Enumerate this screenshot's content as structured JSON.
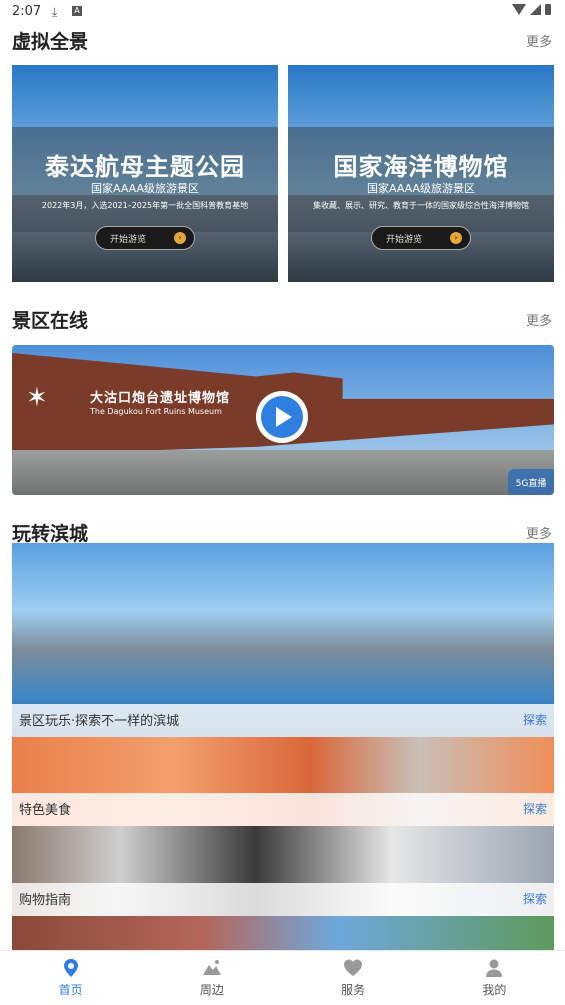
{
  "status": {
    "time": "2:07"
  },
  "virtual_panorama": {
    "title": "虚拟全景",
    "more": "更多",
    "cards": [
      {
        "title": "泰达航母主题公园",
        "grade": "国家AAAA级旅游景区",
        "desc": "2022年3月，入选2021–2025年第一批全国科普教育基地",
        "button": "开始游览"
      },
      {
        "title": "国家海洋博物馆",
        "grade": "国家AAAA级旅游景区",
        "desc": "集收藏、展示、研究、教育于一体的国家级综合性海洋博物馆",
        "button": "开始游览"
      }
    ]
  },
  "scenic_online": {
    "title": "景区在线",
    "more": "更多",
    "live": {
      "name": "大沽口炮台遗址博物馆",
      "name_en": "The Dagukou Fort Ruins Museum",
      "badge": "5G直播"
    }
  },
  "explore_city": {
    "title": "玩转滨城",
    "more": "更多",
    "items": [
      {
        "label": "景区玩乐·探索不一样的滨城",
        "link": "探索"
      },
      {
        "label": "特色美食",
        "link": "探索"
      },
      {
        "label": "购物指南",
        "link": "探索"
      }
    ]
  },
  "tabbar": {
    "tabs": [
      {
        "label": "首页",
        "icon": "location-pin-icon",
        "active": true
      },
      {
        "label": "周边",
        "icon": "mountain-icon",
        "active": false
      },
      {
        "label": "服务",
        "icon": "heart-icon",
        "active": false
      },
      {
        "label": "我的",
        "icon": "person-icon",
        "active": false
      }
    ]
  },
  "colors": {
    "accent": "#2f7fe0",
    "link": "#3b7ad8"
  }
}
